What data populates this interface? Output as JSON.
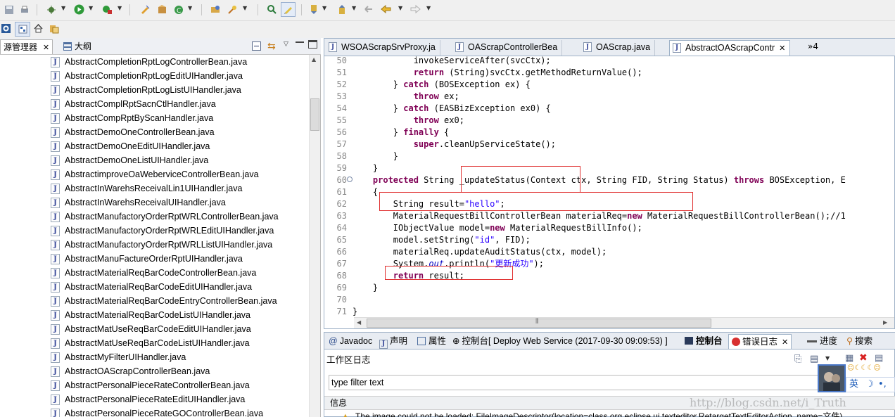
{
  "left_panel": {
    "tab_package_explorer": "源管理器",
    "tab_outline": "大纲",
    "files": [
      "AbstractCompletionRptLogControllerBean.java",
      "AbstractCompletionRptLogEditUIHandler.java",
      "AbstractCompletionRptLogListUIHandler.java",
      "AbstractComplRptSacnCtlHandler.java",
      "AbstractCompRptByScanHandler.java",
      "AbstractDemoOneControllerBean.java",
      "AbstractDemoOneEditUIHandler.java",
      "AbstractDemoOneListUIHandler.java",
      "AbstractimproveOaWeberviceControllerBean.java",
      "AbstractInWarehsReceivalLin1UIHandler.java",
      "AbstractInWarehsReceivalUIHandler.java",
      "AbstractManufactoryOrderRptWRLControllerBean.java",
      "AbstractManufactoryOrderRptWRLEditUIHandler.java",
      "AbstractManufactoryOrderRptWRLListUIHandler.java",
      "AbstractManuFactureOrderRptUIHandler.java",
      "AbstractMaterialReqBarCodeControllerBean.java",
      "AbstractMaterialReqBarCodeEditUIHandler.java",
      "AbstractMaterialReqBarCodeEntryControllerBean.java",
      "AbstractMaterialReqBarCodeListUIHandler.java",
      "AbstractMatUseReqBarCodeEditUIHandler.java",
      "AbstractMatUseReqBarCodeListUIHandler.java",
      "AbstractMyFilterUIHandler.java",
      "AbstractOAScrapControllerBean.java",
      "AbstractPersonalPieceRateControllerBean.java",
      "AbstractPersonalPieceRateEditUIHandler.java",
      "AbstractPersonalPieceRateGOControllerBean.java"
    ]
  },
  "editor": {
    "tabs": [
      "WSOAScrapSrvProxy.ja",
      "OAScrapControllerBea",
      "OAScrap.java",
      "AbstractOAScrapContr"
    ],
    "overflow_count": "»4",
    "lines": [
      {
        "n": "50",
        "segs": [
          {
            "t": "            invokeServiceAfter(svcCtx);",
            "c": ""
          }
        ]
      },
      {
        "n": "51",
        "segs": [
          {
            "t": "            ",
            "c": ""
          },
          {
            "t": "return",
            "c": "kw"
          },
          {
            "t": " (String)svcCtx.getMethodReturnValue();",
            "c": ""
          }
        ]
      },
      {
        "n": "52",
        "segs": [
          {
            "t": "        } ",
            "c": ""
          },
          {
            "t": "catch",
            "c": "kw"
          },
          {
            "t": " (BOSException ex) {",
            "c": ""
          }
        ]
      },
      {
        "n": "53",
        "segs": [
          {
            "t": "            ",
            "c": ""
          },
          {
            "t": "throw",
            "c": "kw"
          },
          {
            "t": " ex;",
            "c": ""
          }
        ]
      },
      {
        "n": "54",
        "segs": [
          {
            "t": "        } ",
            "c": ""
          },
          {
            "t": "catch",
            "c": "kw"
          },
          {
            "t": " (EASBizException ex0) {",
            "c": ""
          }
        ]
      },
      {
        "n": "55",
        "segs": [
          {
            "t": "            ",
            "c": ""
          },
          {
            "t": "throw",
            "c": "kw"
          },
          {
            "t": " ex0;",
            "c": ""
          }
        ]
      },
      {
        "n": "56",
        "segs": [
          {
            "t": "        } ",
            "c": ""
          },
          {
            "t": "finally",
            "c": "kw"
          },
          {
            "t": " {",
            "c": ""
          }
        ]
      },
      {
        "n": "57",
        "segs": [
          {
            "t": "            ",
            "c": ""
          },
          {
            "t": "super",
            "c": "kw"
          },
          {
            "t": ".cleanUpServiceState();",
            "c": ""
          }
        ]
      },
      {
        "n": "58",
        "segs": [
          {
            "t": "        }",
            "c": ""
          }
        ]
      },
      {
        "n": "59",
        "segs": [
          {
            "t": "    }",
            "c": ""
          }
        ]
      },
      {
        "n": "60",
        "segs": [
          {
            "t": "    ",
            "c": ""
          },
          {
            "t": "protected",
            "c": "kw"
          },
          {
            "t": " String _updateStatus(Context ctx, String FID, String Status) ",
            "c": ""
          },
          {
            "t": "throws",
            "c": "kw"
          },
          {
            "t": " BOSException, E",
            "c": ""
          }
        ]
      },
      {
        "n": "61",
        "segs": [
          {
            "t": "    {",
            "c": ""
          }
        ]
      },
      {
        "n": "62",
        "segs": [
          {
            "t": "        String result=",
            "c": ""
          },
          {
            "t": "\"hello\"",
            "c": "str"
          },
          {
            "t": ";",
            "c": ""
          }
        ]
      },
      {
        "n": "63",
        "segs": [
          {
            "t": "        MaterialRequestBillControllerBean materialReq=",
            "c": ""
          },
          {
            "t": "new",
            "c": "kw"
          },
          {
            "t": " MaterialRequestBillControllerBean();//1",
            "c": ""
          }
        ]
      },
      {
        "n": "64",
        "segs": [
          {
            "t": "        IObjectValue model=",
            "c": ""
          },
          {
            "t": "new",
            "c": "kw"
          },
          {
            "t": " MaterialRequestBillInfo();",
            "c": ""
          }
        ]
      },
      {
        "n": "65",
        "segs": [
          {
            "t": "        model.setString(",
            "c": ""
          },
          {
            "t": "\"id\"",
            "c": "str"
          },
          {
            "t": ", FID);",
            "c": ""
          }
        ]
      },
      {
        "n": "66",
        "segs": [
          {
            "t": "        materialReq.updateAuditStatus(ctx, model);",
            "c": ""
          }
        ]
      },
      {
        "n": "67",
        "segs": [
          {
            "t": "        System.",
            "c": ""
          },
          {
            "t": "out",
            "c": "ital"
          },
          {
            "t": ".println(",
            "c": ""
          },
          {
            "t": "\"更新成功\"",
            "c": "str"
          },
          {
            "t": ");",
            "c": ""
          }
        ]
      },
      {
        "n": "68",
        "segs": [
          {
            "t": "        ",
            "c": ""
          },
          {
            "t": "return",
            "c": "kw"
          },
          {
            "t": " result;",
            "c": ""
          }
        ]
      },
      {
        "n": "69",
        "segs": [
          {
            "t": "    }",
            "c": ""
          }
        ]
      },
      {
        "n": "70",
        "segs": [
          {
            "t": "",
            "c": ""
          }
        ]
      },
      {
        "n": "71",
        "segs": [
          {
            "t": "}",
            "c": ""
          }
        ]
      }
    ]
  },
  "bottom_panel": {
    "tabs": {
      "javadoc": "Javadoc",
      "declaration": "声明",
      "properties": "属性",
      "console_deploy": "控制台[  Deploy Web Service (2017-09-30 09:09:53) ]",
      "console": "控制台",
      "error_log": "错误日志",
      "progress": "进度",
      "search": "搜索"
    },
    "title": "工作区日志",
    "filter_placeholder": "type filter text",
    "column_message": "信息",
    "message": "The image could not be loaded: FileImageDescriptor(location=class org.eclipse.ui.texteditor.RetargetTextEditorAction, name=文件)"
  },
  "ime": {
    "mode": "英"
  },
  "watermark": "http://blog.csdn.net/i_Truth"
}
